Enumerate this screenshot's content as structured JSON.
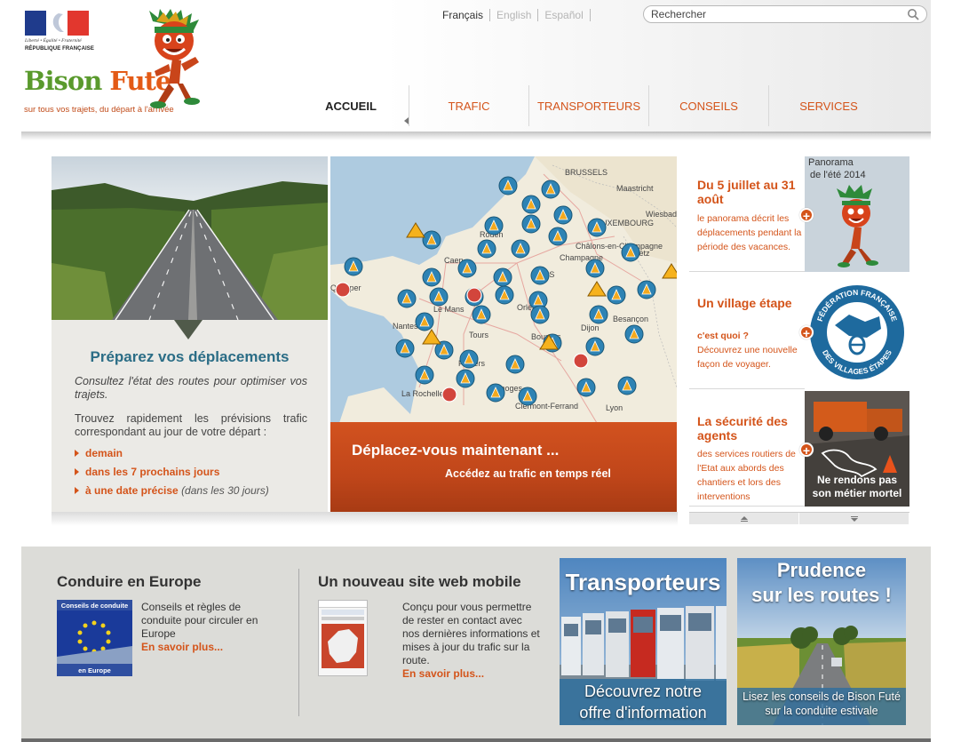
{
  "header": {
    "republic": {
      "motto": "Liberté • Égalité • Fraternité",
      "name": "RÉPUBLIQUE FRANÇAISE"
    },
    "brand": {
      "name_left": "Bison ",
      "name_right": "Futé",
      "tagline": "sur tous vos trajets, du départ à l'arrivée"
    },
    "languages": [
      {
        "label": "Français",
        "active": true
      },
      {
        "label": "English",
        "active": false
      },
      {
        "label": "Español",
        "active": false
      }
    ],
    "search": {
      "placeholder": "Rechercher"
    },
    "nav": [
      "ACCUEIL",
      "TRAFIC",
      "TRANSPORTEURS",
      "CONSEILS",
      "SERVICES"
    ]
  },
  "prepare": {
    "title": "Préparez vos déplacements",
    "intro": "Consultez l'état des routes pour optimiser vos trajets.",
    "find": "Trouvez rapidement les prévisions trafic correspondant au jour de votre départ :",
    "links": [
      {
        "label": "demain",
        "note": ""
      },
      {
        "label": "dans les 7 prochains jours",
        "note": ""
      },
      {
        "label": "à une date précise",
        "note": "(dans les 30 jours)"
      }
    ]
  },
  "map": {
    "cities": [
      "BRUSSELS",
      "Maastricht",
      "LUXEMBOURG",
      "Wiesbade",
      "Châlons-en-Champagne",
      "Champagne",
      "Rouen",
      "Caen",
      "PARIS",
      "Metz",
      "Quimper",
      "Le Mans",
      "Orléans",
      "Nantes",
      "Tours",
      "Dijon",
      "Besançon",
      "Bourges",
      "Poitiers",
      "La Rochelle",
      "Limoges",
      "Clermont-Ferrand",
      "Lyon"
    ],
    "cta_title": "Déplacez-vous maintenant ...",
    "cta_sub": "Accédez au trafic en temps réel"
  },
  "promos": [
    {
      "title": "Du 5 juillet au 31 août",
      "lead": "",
      "text": "le panorama décrit les déplacements pendant la période des vacances.",
      "image_caption_1": "Panorama",
      "image_caption_2": "de l'été 2014"
    },
    {
      "title": "Un village étape",
      "lead": "c'est quoi ?",
      "text": "Découvrez une nouvelle façon de voyager.",
      "badge_top": "FÉDÉRATION FRANÇAISE",
      "badge_bottom": "DES VILLAGES ÉTAPES"
    },
    {
      "title": "La sécurité des agents",
      "lead": "",
      "text": "des services routiers de l'Etat aux abords des chantiers et lors des interventions",
      "image_caption_1": "Ne rendons pas",
      "image_caption_2": "son métier mortel"
    }
  ],
  "bottom": {
    "europe": {
      "title": "Conduire en Europe",
      "thumb_top": "Conseils de conduite",
      "thumb_bottom": "en Europe",
      "text": "Conseils et règles de conduite pour circuler en Europe",
      "link": "En savoir plus..."
    },
    "mobile": {
      "title": "Un nouveau site web mobile",
      "text": "Conçu pour vous permettre de rester en contact avec nos dernières informations et mises à jour du trafic sur la route.",
      "link": "En savoir plus..."
    },
    "transporteurs": {
      "title": "Transporteurs",
      "sub_1": "Découvrez notre",
      "sub_2": "offre d'information"
    },
    "prudence": {
      "title_1": "Prudence",
      "title_2": "sur les routes !",
      "sub_1": "Lisez les conseils de Bison Futé",
      "sub_2": "sur la conduite estivale"
    }
  },
  "colors": {
    "accent": "#d4541a",
    "brand_green": "#5a9a2d",
    "title_blue": "#2b6d86"
  }
}
